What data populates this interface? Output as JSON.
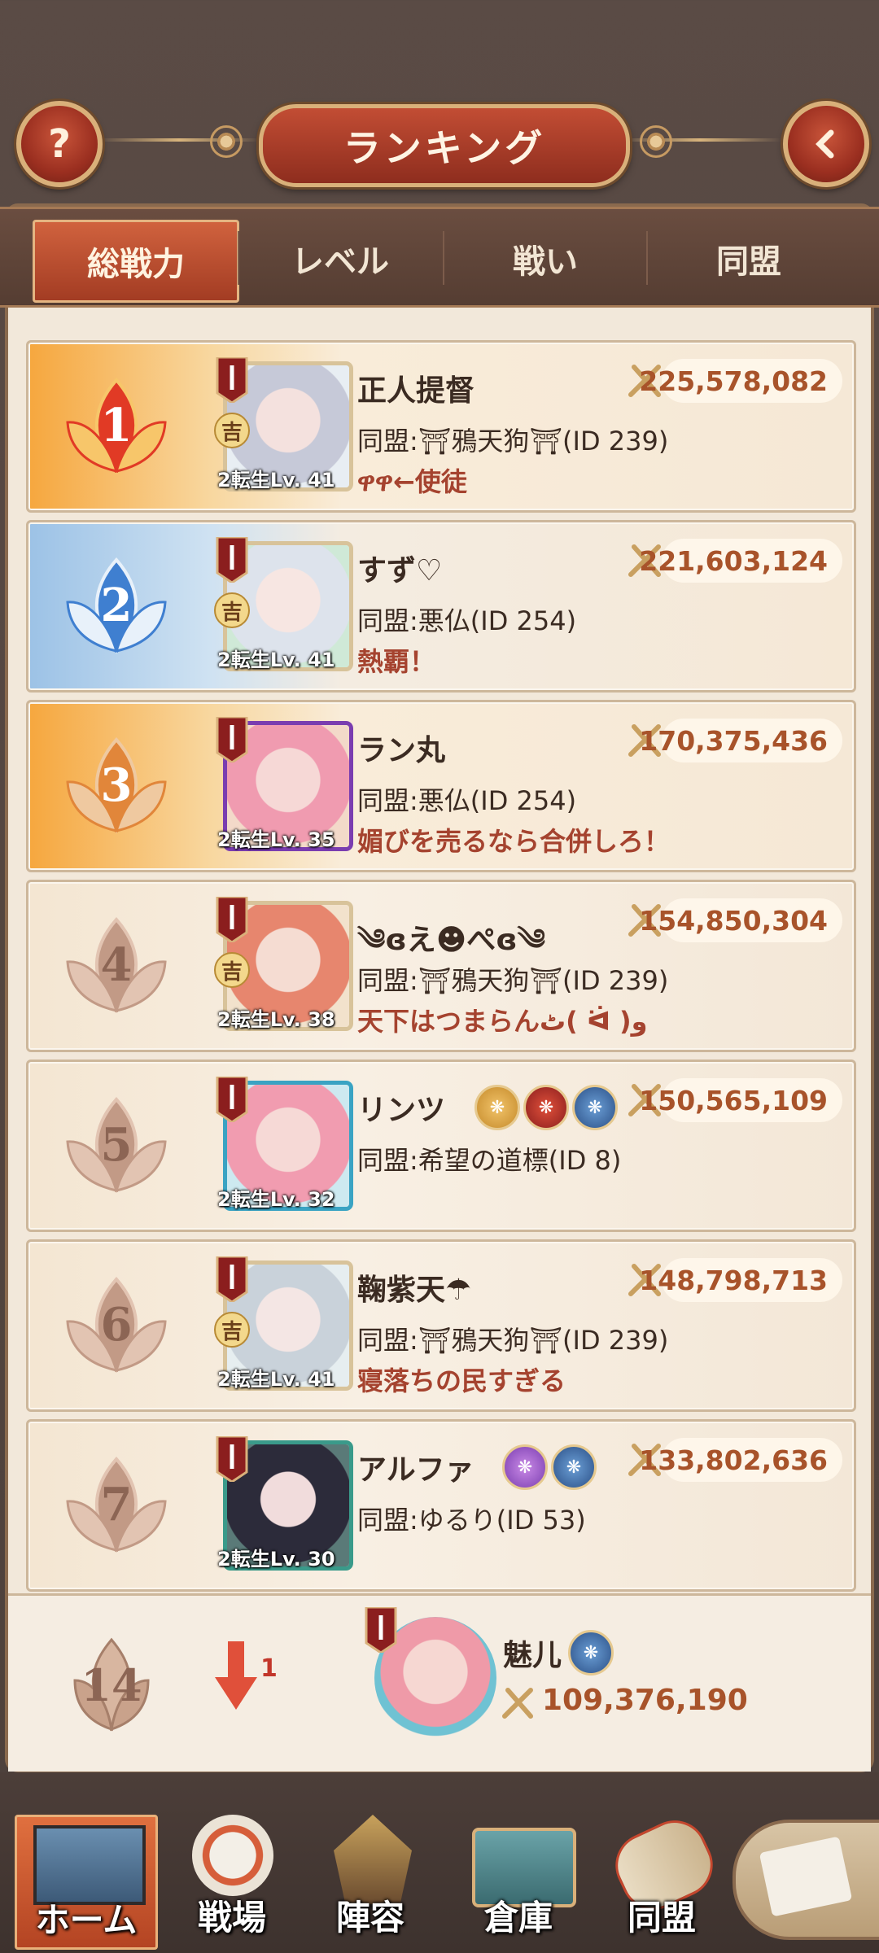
{
  "header": {
    "title": "ランキング",
    "help_icon": "question-icon",
    "back_icon": "chevron-left-icon"
  },
  "tabs": [
    {
      "label": "総戦力",
      "active": true
    },
    {
      "label": "レベル",
      "active": false
    },
    {
      "label": "戦い",
      "active": false
    },
    {
      "label": "同盟",
      "active": false
    }
  ],
  "rankings": [
    {
      "rank": "1",
      "name": "正人提督",
      "level": "2転生Lv. 41",
      "power": "225,578,082",
      "alliance": "同盟:⛩鴉天狗⛩(ID 239)",
      "motto": "ዋዋ←使徒",
      "kichi": true
    },
    {
      "rank": "2",
      "name": "すず♡",
      "level": "2転生Lv. 41",
      "power": "221,603,124",
      "alliance": "同盟:悪仏(ID 254)",
      "motto": "熱覇！",
      "kichi": true
    },
    {
      "rank": "3",
      "name": "ラン丸",
      "level": "2転生Lv. 35",
      "power": "170,375,436",
      "alliance": "同盟:悪仏(ID 254)",
      "motto": "媚びを売るなら合併しろ！",
      "kichi": false
    },
    {
      "rank": "4",
      "name": "༄ɞえ☻ぺɞ༄",
      "level": "2転生Lv. 38",
      "power": "154,850,304",
      "alliance": "同盟:⛩鴉天狗⛩(ID 239)",
      "motto": "天下はつまらんٹ( ᐛ )و",
      "kichi": true
    },
    {
      "rank": "5",
      "name": "リンツ",
      "level": "2転生Lv. 32",
      "power": "150,565,109",
      "alliance": "同盟:希望の道標(ID 8)",
      "motto": "",
      "kichi": false
    },
    {
      "rank": "6",
      "name": "鞠紫天☂",
      "level": "2転生Lv. 41",
      "power": "148,798,713",
      "alliance": "同盟:⛩鴉天狗⛩(ID 239)",
      "motto": "寝落ちの民すぎる",
      "kichi": true
    },
    {
      "rank": "7",
      "name": "アルファ",
      "level": "2転生Lv. 30",
      "power": "133,802,636",
      "alliance": "同盟:ゆるり(ID 53)",
      "motto": "",
      "kichi": false
    }
  ],
  "self": {
    "rank": "14",
    "change": "1",
    "name": "魅儿",
    "power": "109,376,190"
  },
  "bottom_nav": [
    {
      "label": "ホーム",
      "active": true
    },
    {
      "label": "戦場",
      "active": false
    },
    {
      "label": "陣容",
      "active": false
    },
    {
      "label": "倉庫",
      "active": false
    },
    {
      "label": "同盟",
      "active": false
    }
  ],
  "colors": {
    "accent_red": "#a33c23",
    "gold_border": "#d9b07a",
    "power_text": "#a8532a",
    "motto_text": "#a5432f"
  }
}
